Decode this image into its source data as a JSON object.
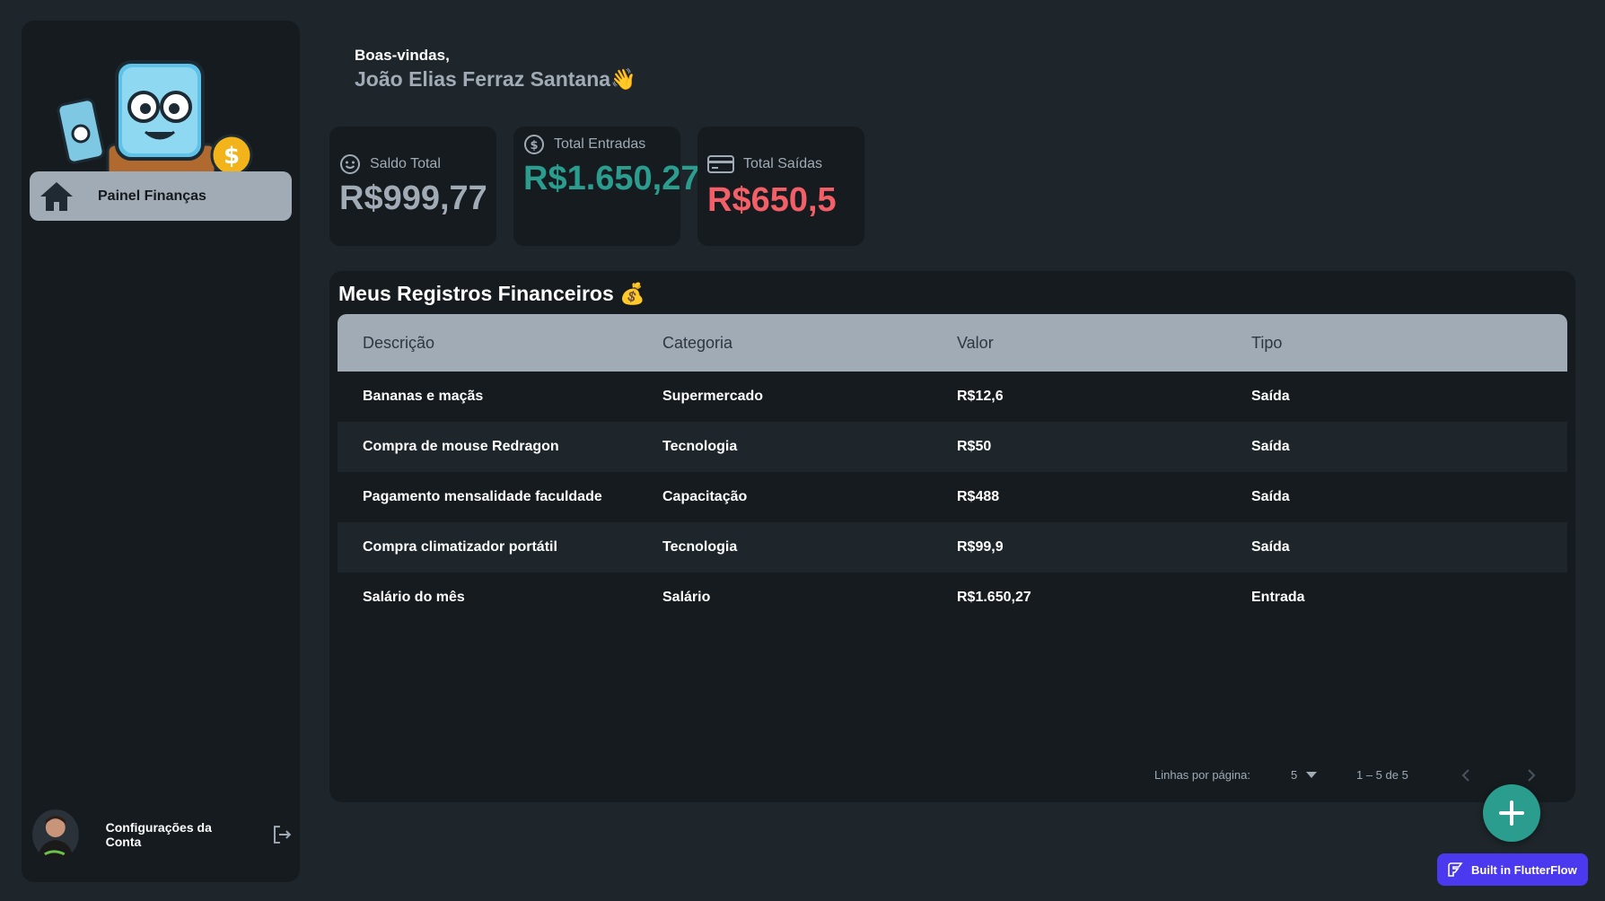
{
  "sidebar": {
    "nav_label": "Painel Finanças",
    "account_label": "Configurações da Conta"
  },
  "header": {
    "greeting": "Boas-vindas,",
    "user_name": "João Elias Ferraz Santana",
    "wave_emoji": "👋"
  },
  "stats": [
    {
      "label": "Saldo Total",
      "value": "R$999,77",
      "color": "#a0abb5",
      "icon": "smiley-icon"
    },
    {
      "label": "Total Entradas",
      "value": "R$1.650,27",
      "color": "#2a9d8f",
      "icon": "dollar-circle-icon"
    },
    {
      "label": "Total Saídas",
      "value": "R$650,5",
      "color": "#f25f66",
      "icon": "credit-card-icon"
    }
  ],
  "table": {
    "title": "Meus Registros Financeiros",
    "title_emoji": "💰",
    "headers": [
      "Descrição",
      "Categoria",
      "Valor",
      "Tipo"
    ],
    "rows": [
      [
        "Bananas e maçãs",
        "Supermercado",
        "R$12,6",
        "Saída"
      ],
      [
        "Compra de mouse Redragon",
        "Tecnologia",
        "R$50",
        "Saída"
      ],
      [
        "Pagamento mensalidade faculdade",
        "Capacitação",
        "R$488",
        "Saída"
      ],
      [
        "Compra climatizador portátil",
        "Tecnologia",
        "R$99,9",
        "Saída"
      ],
      [
        "Salário do mês",
        "Salário",
        "R$1.650,27",
        "Entrada"
      ]
    ]
  },
  "pagination": {
    "rows_per_page_label": "Linhas por página:",
    "rows_per_page": "5",
    "range": "1 – 5 de 5"
  },
  "badge_label": "Built in FlutterFlow",
  "colors": {
    "background": "#1e262b",
    "panel": "#151b1f",
    "accent": "#a0abb5",
    "income": "#2a9d8f",
    "expense": "#f25f66",
    "flutterflow": "#4b39ef"
  }
}
